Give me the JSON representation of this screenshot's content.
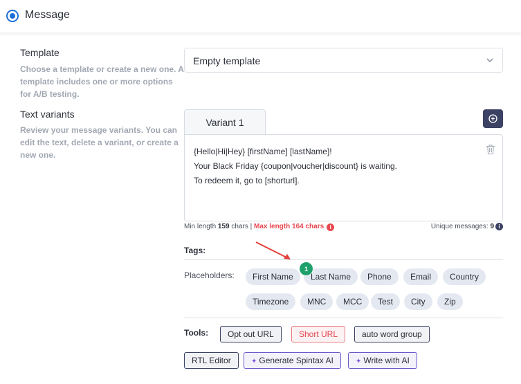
{
  "header": {
    "title": "Message"
  },
  "template": {
    "label": "Template",
    "description_lines": [
      "Choose a template or create a new one. A",
      "template includes one or more options",
      "for A/B testing."
    ],
    "selected": "Empty template"
  },
  "variants": {
    "label": "Text variants",
    "description_lines": [
      "Review your message variants. You can",
      "edit the text, delete a variant, or create a",
      "new one."
    ],
    "tab_label": "Variant 1",
    "text_lines": [
      "{Hello|Hi|Hey} [firstName] [lastName]!",
      "Your Black Friday {coupon|voucher|discount} is waiting.",
      "To redeem it, go to [shorturl]."
    ],
    "min_prefix": "Min length ",
    "min_value": "159",
    "min_suffix": " chars | ",
    "max_text": "Max length 164 chars",
    "unique_prefix": "Unique messages: ",
    "unique_value": "9",
    "info_glyph": "i"
  },
  "tags": {
    "label": "Tags:",
    "placeholders_label": "Placeholders:",
    "placeholders": [
      "First Name",
      "Last Name",
      "Phone",
      "Email",
      "Country",
      "Timezone",
      "MNC",
      "MCC",
      "Test",
      "City",
      "Zip"
    ],
    "badge": "1"
  },
  "tools": {
    "label": "Tools:",
    "buttons": [
      "Opt out URL",
      "Short URL",
      "auto word group",
      "RTL Editor",
      "Generate Spintax AI",
      "Write with AI"
    ]
  },
  "colors": {
    "accent": "#1c6fd8",
    "dark": "#3c4263",
    "danger": "#e8484f",
    "chip": "#e4e8f1",
    "badge": "#1fa06a"
  },
  "icons": [
    "radio-selected-icon",
    "chevron-down-icon",
    "plus-circle-icon",
    "trash-icon",
    "info-icon",
    "sparkle-icon",
    "annotation-arrow-icon"
  ]
}
